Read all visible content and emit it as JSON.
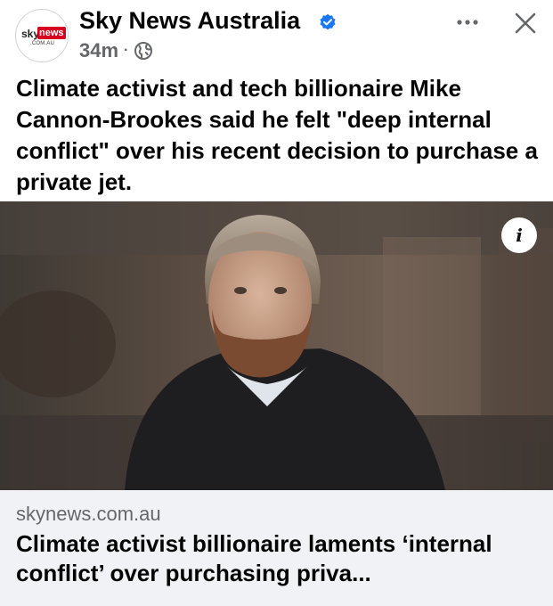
{
  "header": {
    "page_name": "Sky News Australia",
    "timestamp": "34m",
    "separator": "·",
    "privacy_icon": "globe-icon",
    "verified_icon": "verified-badge-icon",
    "more_icon": "more-horizontal-icon",
    "close_icon": "close-icon"
  },
  "avatar": {
    "logo_sky": "sky",
    "logo_news": "news",
    "logo_domain": ".COM.AU"
  },
  "post": {
    "caption": "Climate activist and tech billionaire Mike Cannon-Brookes said he felt \"deep internal conflict\" over his recent decision to purchase a private jet."
  },
  "photo": {
    "info_label": "i"
  },
  "link_preview": {
    "domain": "skynews.com.au",
    "title": "Climate activist billionaire laments ‘internal conflict’ over purchasing priva..."
  },
  "colors": {
    "verified_blue": "#1877f2",
    "meta_gray": "#65676b",
    "card_background": "#f0f2f5",
    "sky_news_red": "#d7001e"
  }
}
